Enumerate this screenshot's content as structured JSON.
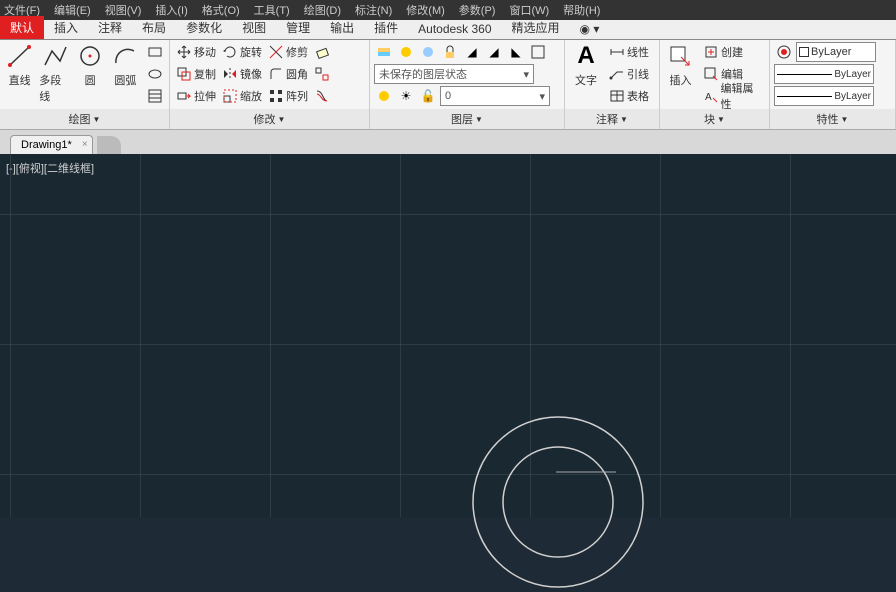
{
  "top_menu": [
    "文件(F)",
    "编辑(E)",
    "视图(V)",
    "插入(I)",
    "格式(O)",
    "工具(T)",
    "绘图(D)",
    "标注(N)",
    "修改(M)",
    "参数(P)",
    "窗口(W)",
    "帮助(H)"
  ],
  "ribbon_tabs": [
    "默认",
    "插入",
    "注释",
    "布局",
    "参数化",
    "视图",
    "管理",
    "输出",
    "插件",
    "Autodesk 360",
    "精选应用",
    "◉ ▾"
  ],
  "active_tab_index": 0,
  "draw": {
    "title": "绘图",
    "line": "直线",
    "polyline": "多段线",
    "circle": "圆",
    "arc": "圆弧"
  },
  "modify": {
    "title": "修改",
    "move": "移动",
    "rotate": "旋转",
    "trim": "修剪",
    "copy": "复制",
    "mirror": "镜像",
    "fillet": "圆角",
    "stretch": "拉伸",
    "scale": "缩放",
    "array": "阵列"
  },
  "layer": {
    "title": "图层",
    "state": "未保存的图层状态"
  },
  "annotate": {
    "title": "注释",
    "text": "文字",
    "linear": "线性",
    "leader": "引线",
    "table": "表格"
  },
  "block": {
    "title": "块",
    "insert": "插入",
    "create": "创建",
    "edit": "编辑",
    "editattr": "编辑属性"
  },
  "props": {
    "title": "特性",
    "bylayer": "ByLayer"
  },
  "doc_tab": "Drawing1*",
  "view_label": "[-][俯视][二维线框]"
}
